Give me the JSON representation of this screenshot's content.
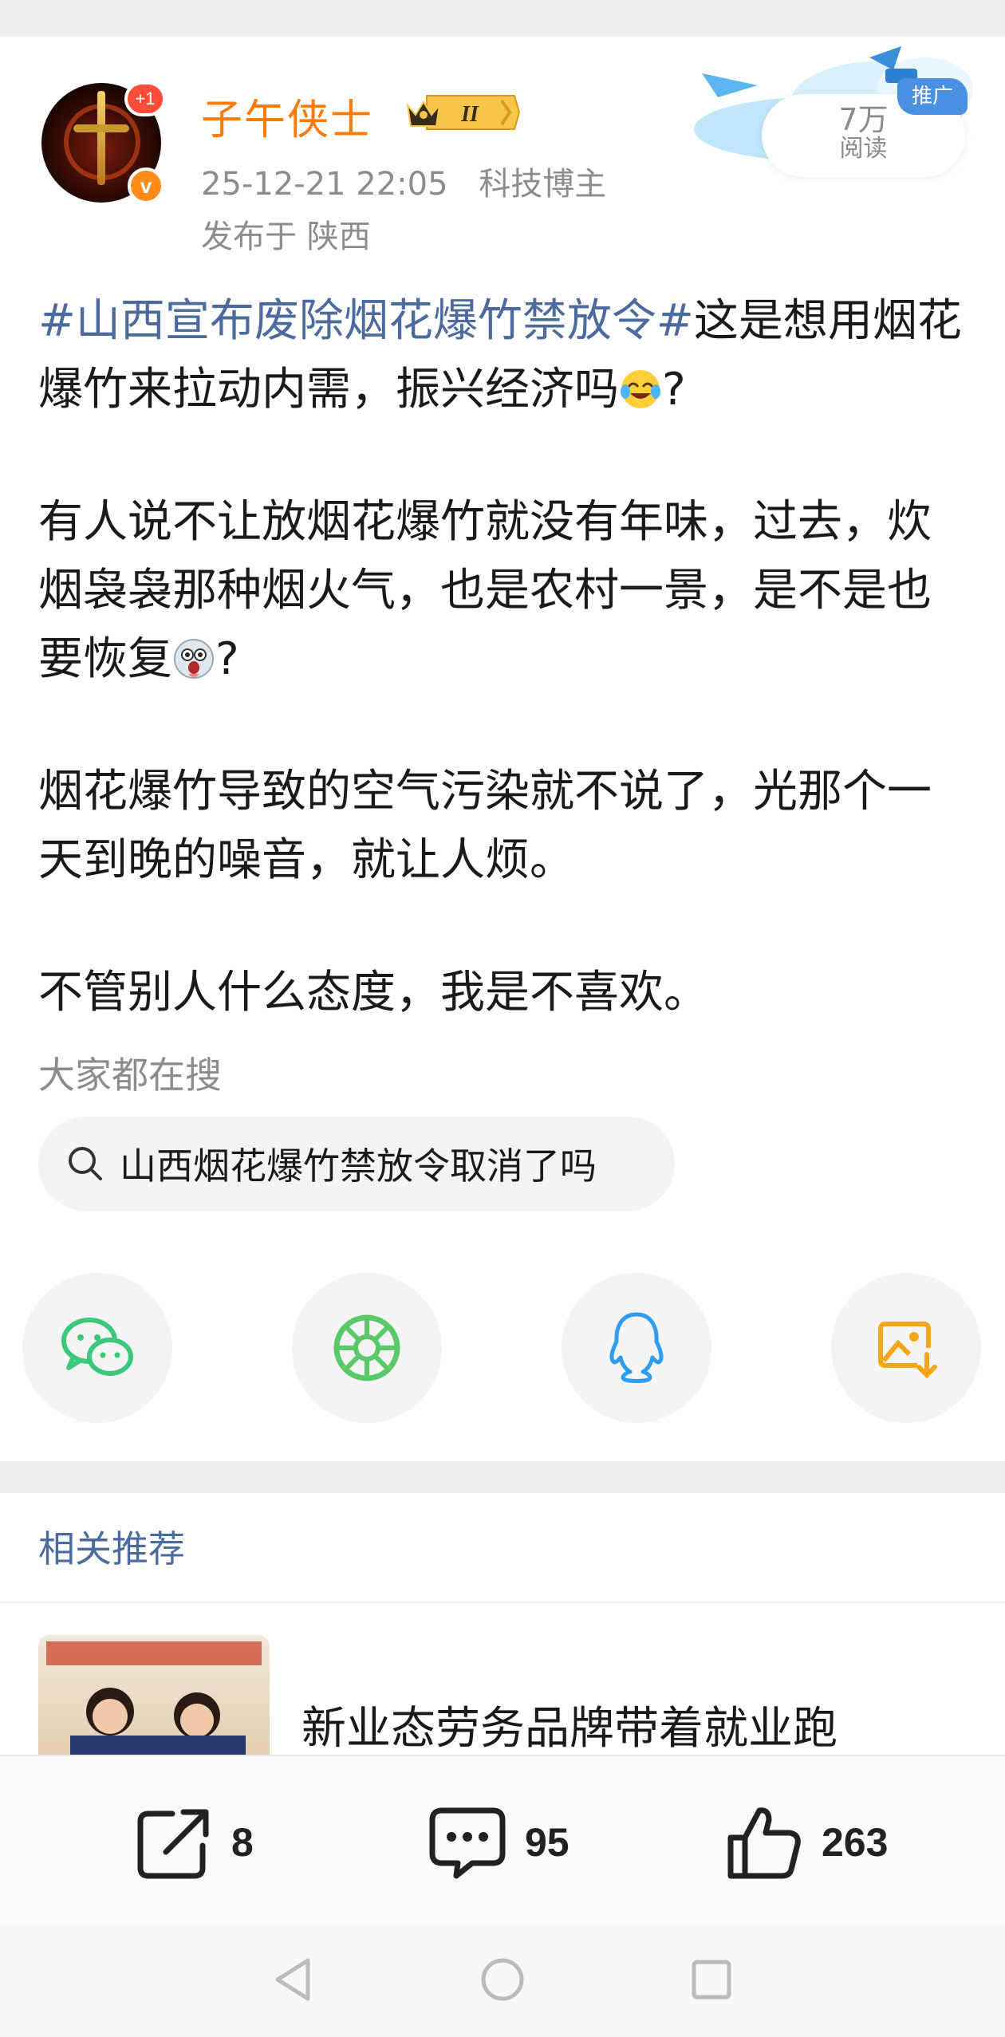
{
  "author": {
    "name": "子午侠士",
    "vip_level": "II",
    "follow_badge": "+1",
    "verified_mark": "v"
  },
  "meta": {
    "timestamp": "25-12-21 22:05",
    "role": "科技博主",
    "location": "发布于 陕西"
  },
  "promo": {
    "tag": "推广",
    "count": "7万",
    "read_label": "阅读"
  },
  "post": {
    "hashtag": "#山西宣布废除烟花爆竹禁放令#",
    "p1_text": "这是想用烟花爆竹来拉动内需，振兴经济吗",
    "p1_end": "?",
    "p2_text": "有人说不让放烟花爆竹就没有年味，过去，炊烟袅袅那种烟火气，也是农村一景，是不是也要恢复",
    "p2_end": "?",
    "p3": "烟花爆竹导致的空气污染就不说了，光那个一天到晚的噪音，就让人烦。",
    "p4": "不管别人什么态度，我是不喜欢。",
    "emoji_1": "laugh-cry-emoji",
    "emoji_2": "shocked-emoji"
  },
  "search": {
    "label": "大家都在搜",
    "query": "山西烟花爆竹禁放令取消了吗"
  },
  "share_targets": [
    "wechat-icon",
    "moments-icon",
    "qq-icon",
    "save-image-icon"
  ],
  "related": {
    "title": "相关推荐",
    "article": "新业态劳务品牌带着就业跑"
  },
  "actions": {
    "repost_count": "8",
    "comment_count": "95",
    "like_count": "263"
  },
  "colors": {
    "username": "#ff7a00",
    "hashtag": "#4b6b9e",
    "wechat": "#3cc87a",
    "moments": "#5bc86a",
    "qq": "#2e9cf0",
    "save": "#f2a71b"
  }
}
